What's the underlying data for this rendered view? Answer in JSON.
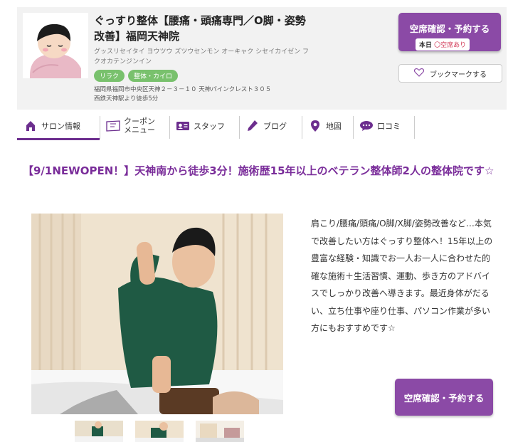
{
  "salon": {
    "name": "ぐっすり整体【腰痛・頭痛専門／O脚・姿勢改善】福岡天神院",
    "name_kana": "グッスリセイタイ ヨウツウ ズツウセンモン オーキャク シセイカイゼン フクオカテンジンイン",
    "tags": [
      "リラク",
      "整体・カイロ"
    ],
    "address": "福岡県福岡市中央区天神２－３－１０ 天神パインクレスト３０５",
    "access": "西鉄天神駅より徒歩5分"
  },
  "header_buttons": {
    "reserve_label": "空席確認・予約する",
    "today_label": "本日",
    "availability_label": "〇空席あり",
    "bookmark_label": "ブックマークする"
  },
  "tabs": [
    {
      "label": "サロン情報",
      "icon": "home-icon",
      "active": true
    },
    {
      "label_line1": "クーポン",
      "label_line2": "メニュー",
      "icon": "coupon-icon"
    },
    {
      "label": "スタッフ",
      "icon": "staff-card-icon"
    },
    {
      "label": "ブログ",
      "icon": "pencil-icon"
    },
    {
      "label": "地図",
      "icon": "map-pin-icon"
    },
    {
      "label": "口コミ",
      "icon": "chat-bubble-icon"
    }
  ],
  "main": {
    "catch_copy": "【9/1NEWOPEN！】天神南から徒歩3分！施術歴15年以上のベテラン整体師2人の整体院です☆",
    "description": "肩こり/腰痛/頭痛/O脚/X脚/姿勢改善など…本気で改善したい方はぐっすり整体へ！15年以上の豊富な経験・知識でお一人お一人に合わせた的確な施術＋生活習慣、運動、歩き方のアドバイスでしっかり改善へ導きます。最近身体がだるい、立ち仕事や座り仕事、パソコン作業が多い方にもおすすめです☆",
    "reserve_label": "空席確認・予約する"
  },
  "colors": {
    "accent_purple": "#8b4aa6",
    "catch_purple": "#7a2d9a",
    "tag_green": "#79c16d",
    "availability_red": "#d3415d",
    "header_bg": "#f2f2f2"
  }
}
